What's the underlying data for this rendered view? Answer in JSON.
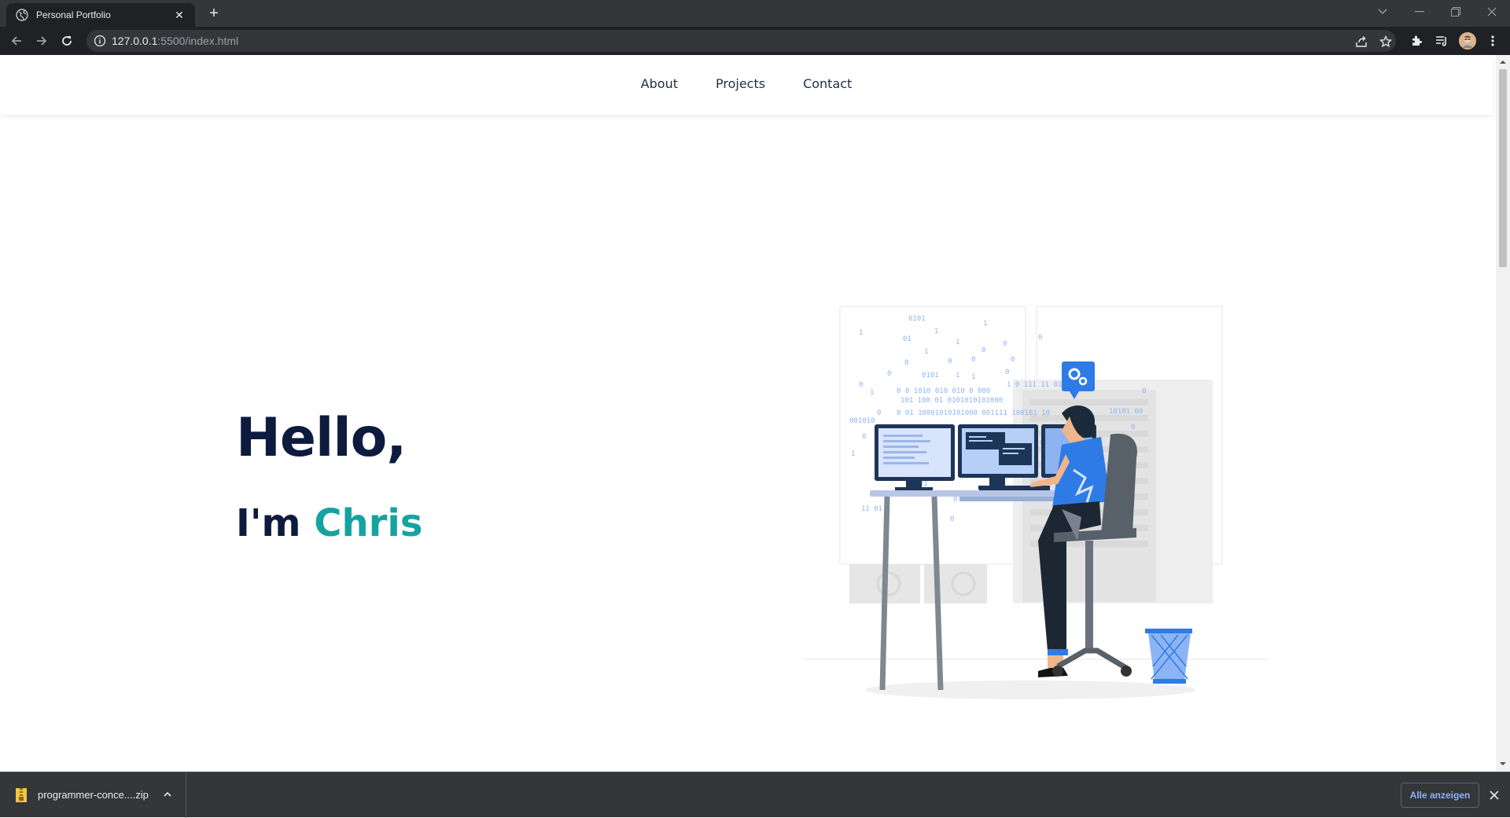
{
  "browser": {
    "tab_title": "Personal Portfolio",
    "tab_close": "✕",
    "new_tab": "+",
    "url_host": "127.0.0.1",
    "url_path": ":5500/index.html"
  },
  "nav": {
    "links": [
      "About",
      "Projects",
      "Contact"
    ]
  },
  "hero": {
    "greeting": "Hello,",
    "intro_prefix": "I'm",
    "name": "Chris",
    "name_color": "#14a3a0",
    "heading_color": "#0d1b3e"
  },
  "download_bar": {
    "file_name": "programmer-conce....zip",
    "show_all": "Alle anzeigen"
  }
}
